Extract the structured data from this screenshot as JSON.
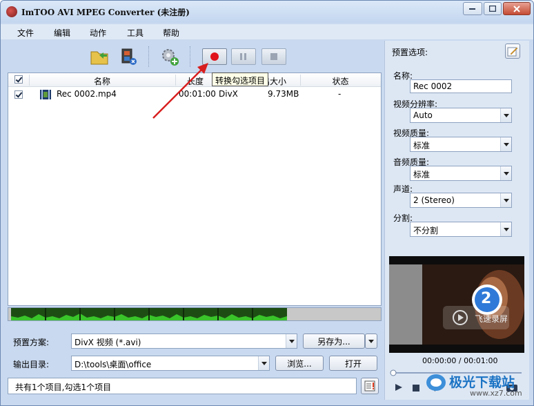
{
  "window": {
    "title": "ImTOO AVI MPEG Converter (未注册)"
  },
  "menu": [
    "文件",
    "编辑",
    "动作",
    "工具",
    "帮助"
  ],
  "toolbar": {
    "tooltip": "转换勾选项目"
  },
  "list": {
    "headers": [
      "名称",
      "长度",
      "输出大小",
      "状态"
    ],
    "rows": [
      {
        "name": "Rec 0002.mp4",
        "duration": "00:01:00",
        "format": "DivX",
        "size": "9.73MB",
        "status": "-"
      }
    ]
  },
  "bottom": {
    "preset_label": "预置方案:",
    "preset_value": "DivX 视频 (*.avi)",
    "save_as": "另存为...",
    "output_label": "输出目录:",
    "output_value": "D:\\tools\\桌面\\office",
    "browse": "浏览...",
    "open": "打开",
    "status": "共有1个项目,勾选1个项目"
  },
  "preset_panel": {
    "title": "预置选项:",
    "name_label": "名称:",
    "name_value": "Rec 0002",
    "resolution_label": "视频分辨率:",
    "resolution_value": "Auto",
    "video_quality_label": "视频质量:",
    "video_quality_value": "标准",
    "audio_quality_label": "音频质量:",
    "audio_quality_value": "标准",
    "channel_label": "声道:",
    "channel_value": "2 (Stereo)",
    "split_label": "分割:",
    "split_value": "不分割"
  },
  "preview": {
    "time": "00:00:00 / 00:01:00",
    "badge": "2",
    "watermark": "飞速录屏"
  },
  "watermark": {
    "site": "极光下载站",
    "url": "www.xz7.com"
  }
}
